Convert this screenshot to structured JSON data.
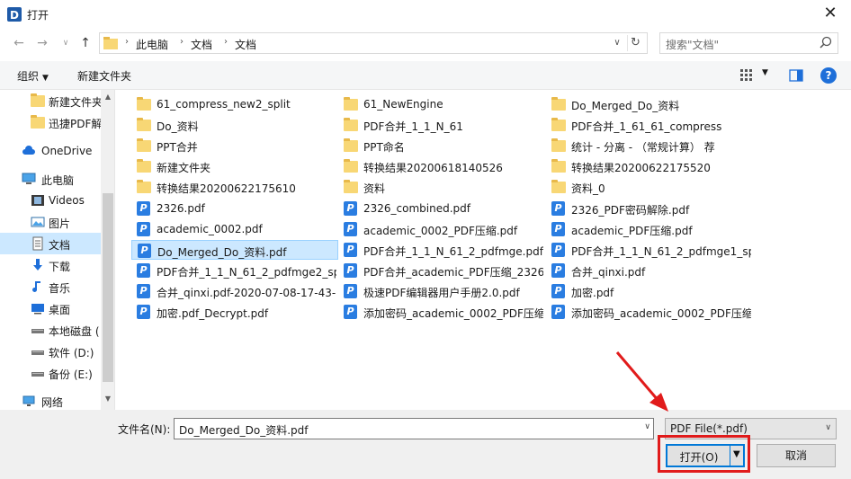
{
  "window": {
    "title": "打开"
  },
  "nav": {
    "breadcrumbs": [
      "此电脑",
      "文档",
      "文档"
    ],
    "search_placeholder": "搜索\"文档\""
  },
  "toolbar": {
    "organize_label": "组织",
    "new_folder_label": "新建文件夹"
  },
  "sidebar": {
    "items": [
      {
        "label": "新建文件夹",
        "icon": "folder-icon"
      },
      {
        "label": "迅捷PDF解",
        "icon": "folder-icon"
      },
      {
        "label": "OneDrive",
        "icon": "cloud-icon"
      },
      {
        "label": "此电脑",
        "icon": "computer-icon"
      },
      {
        "label": "Videos",
        "icon": "video-icon"
      },
      {
        "label": "图片",
        "icon": "picture-icon"
      },
      {
        "label": "文档",
        "icon": "document-icon"
      },
      {
        "label": "下载",
        "icon": "download-icon"
      },
      {
        "label": "音乐",
        "icon": "music-icon"
      },
      {
        "label": "桌面",
        "icon": "desktop-icon"
      },
      {
        "label": "本地磁盘 (",
        "icon": "drive-icon"
      },
      {
        "label": "软件 (D:)",
        "icon": "drive-icon"
      },
      {
        "label": "备份 (E:)",
        "icon": "drive-icon"
      },
      {
        "label": "网络",
        "icon": "network-icon"
      }
    ]
  },
  "files": [
    {
      "name": "61_compress_new2_split",
      "type": "folder"
    },
    {
      "name": "61_NewEngine",
      "type": "folder"
    },
    {
      "name": "Do_Merged_Do_资料",
      "type": "folder"
    },
    {
      "name": "Do_资料",
      "type": "folder"
    },
    {
      "name": "PDF合并_1_1_N_61",
      "type": "folder"
    },
    {
      "name": "PDF合并_1_61_61_compress",
      "type": "folder"
    },
    {
      "name": "PPT合并",
      "type": "folder"
    },
    {
      "name": "PPT命名",
      "type": "folder"
    },
    {
      "name": "统计 - 分离 - （常规计算） 荐",
      "type": "folder"
    },
    {
      "name": "新建文件夹",
      "type": "folder"
    },
    {
      "name": "转换结果20200618140526",
      "type": "folder"
    },
    {
      "name": "转换结果20200622175520",
      "type": "folder"
    },
    {
      "name": "转换结果20200622175610",
      "type": "folder"
    },
    {
      "name": "资料",
      "type": "folder"
    },
    {
      "name": "资料_0",
      "type": "folder"
    },
    {
      "name": "2326.pdf",
      "type": "pdf"
    },
    {
      "name": "2326_combined.pdf",
      "type": "pdf"
    },
    {
      "name": "2326_PDF密码解除.pdf",
      "type": "pdf"
    },
    {
      "name": "academic_0002.pdf",
      "type": "pdf"
    },
    {
      "name": "academic_0002_PDF压缩.pdf",
      "type": "pdf"
    },
    {
      "name": "academic_PDF压缩.pdf",
      "type": "pdf"
    },
    {
      "name": "Do_Merged_Do_资料.pdf",
      "type": "pdf",
      "selected": true
    },
    {
      "name": "PDF合并_1_1_N_61_2_pdfmge.pdf",
      "type": "pdf"
    },
    {
      "name": "PDF合并_1_1_N_61_2_pdfmge1_sp...",
      "type": "pdf"
    },
    {
      "name": "PDF合并_1_1_N_61_2_pdfmge2_sp...",
      "type": "pdf"
    },
    {
      "name": "PDF合并_academic_PDF压缩_2326...",
      "type": "pdf"
    },
    {
      "name": "合并_qinxi.pdf",
      "type": "pdf"
    },
    {
      "name": "合并_qinxi.pdf-2020-07-08-17-43-...",
      "type": "pdf"
    },
    {
      "name": "极速PDF编辑器用户手册2.0.pdf",
      "type": "pdf"
    },
    {
      "name": "加密.pdf",
      "type": "pdf"
    },
    {
      "name": "加密.pdf_Decrypt.pdf",
      "type": "pdf"
    },
    {
      "name": "添加密码_academic_0002_PDF压缩...",
      "type": "pdf"
    },
    {
      "name": "添加密码_academic_0002_PDF压缩...",
      "type": "pdf"
    }
  ],
  "bottom": {
    "filename_label": "文件名(N):",
    "filename_value": "Do_Merged_Do_资料.pdf",
    "filetype_value": "PDF File(*.pdf)",
    "open_label": "打开(O)",
    "cancel_label": "取消"
  },
  "colors": {
    "selection": "#cce8ff",
    "accent": "#0078d7",
    "annotation": "#e11b1b"
  }
}
